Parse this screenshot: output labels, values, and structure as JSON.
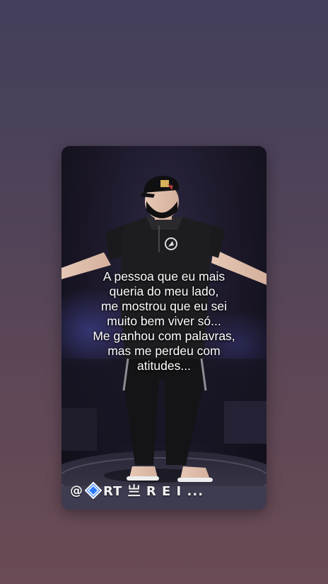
{
  "story": {
    "caption_lines": [
      "A pessoa que eu mais",
      "queria do meu lado,",
      "me mostrou que eu sei",
      "muito bem viver só...",
      "Me ganhou com palavras,",
      "mas me perdeu com",
      "atitudes..."
    ],
    "watermark": {
      "prefix": "@",
      "text": "RT 亗 R E I ...",
      "diamond_color": "#2f7bff"
    }
  },
  "colors": {
    "background_top": "#433f5c",
    "background_bottom": "#6a4b55",
    "card_background": "#1a1626",
    "text": "#ffffff"
  }
}
